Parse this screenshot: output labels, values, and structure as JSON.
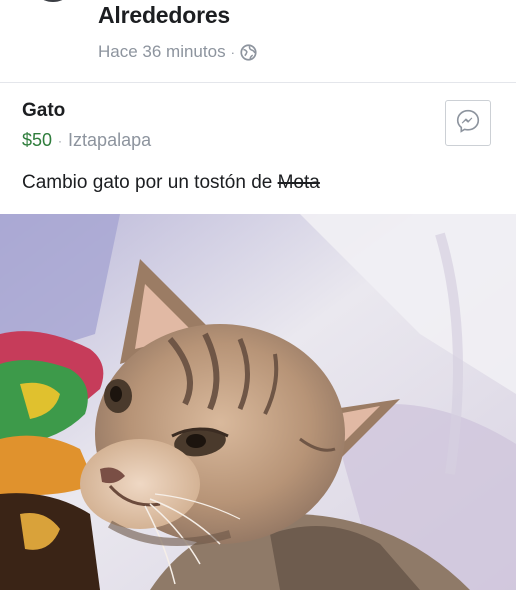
{
  "group": {
    "name": "Alrededores",
    "time": "Hace 36 minutos",
    "separator": "·",
    "privacy_icon": "globe-icon"
  },
  "listing": {
    "title": "Gato",
    "price": "$50",
    "separator": "·",
    "location": "Iztapalapa",
    "description_prefix": "Cambio gato por un tostón de ",
    "description_struck": "Mota",
    "message_icon": "messenger-icon"
  },
  "photo": {
    "subject": "cat-photo"
  },
  "colors": {
    "price_green": "#2f7d3c",
    "meta_gray": "#8d949e",
    "text": "#1c1e21"
  }
}
